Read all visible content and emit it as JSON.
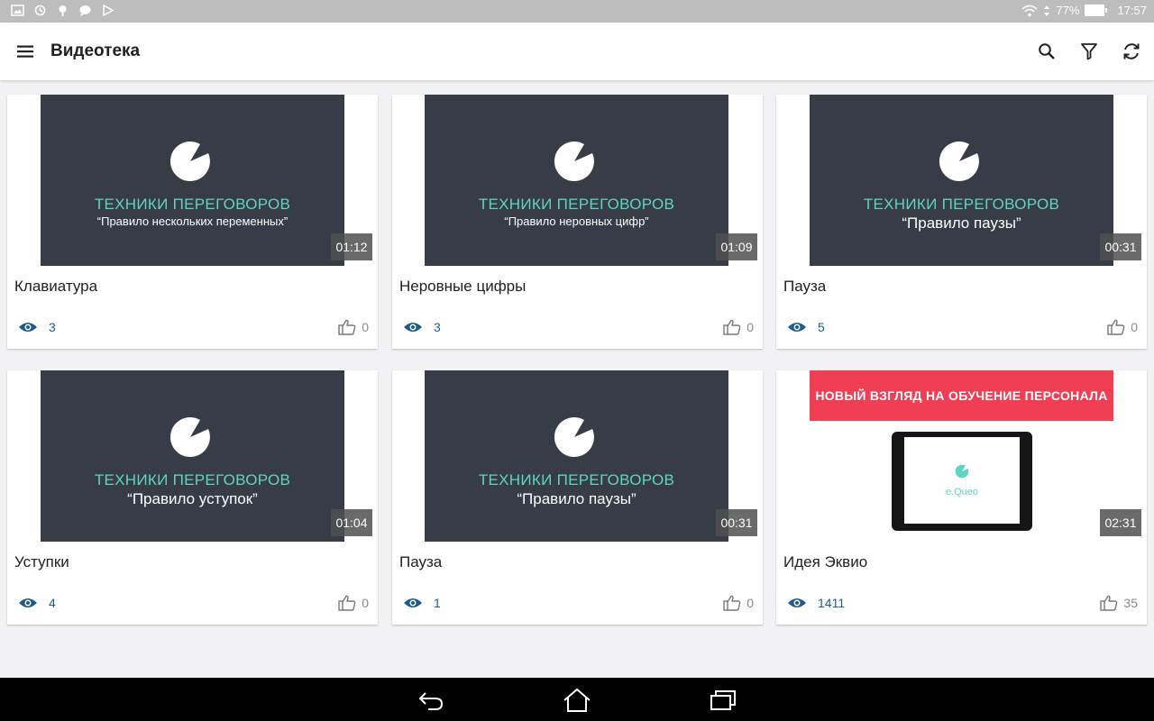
{
  "status_bar": {
    "battery": "77%",
    "time": "17:57"
  },
  "app_bar": {
    "title": "Видеотека"
  },
  "colors": {
    "accent": "#5fd4c4",
    "promo": "#f03e55",
    "views": "#1e5a8c",
    "thumb_bg": "#383c47"
  },
  "icons": {
    "menu": "menu-icon",
    "search": "search-icon",
    "filter": "filter-icon",
    "refresh": "refresh-icon",
    "views": "eye-icon",
    "likes": "thumbs-up-icon",
    "back": "back-icon",
    "home": "home-icon",
    "recents": "recents-icon"
  },
  "videos": [
    {
      "thumb_title": "ТЕХНИКИ ПЕРЕГОВОРОВ",
      "thumb_subtitle": "“Правило нескольких переменных”",
      "duration": "01:12",
      "title": "Клавиатура",
      "views": "3",
      "likes": "0"
    },
    {
      "thumb_title": "ТЕХНИКИ ПЕРЕГОВОРОВ",
      "thumb_subtitle": "“Правило неровных цифр”",
      "duration": "01:09",
      "title": "Неровные цифры",
      "views": "3",
      "likes": "0"
    },
    {
      "thumb_title": "ТЕХНИКИ ПЕРЕГОВОРОВ",
      "thumb_subtitle": "“Правило паузы”",
      "duration": "00:31",
      "title": "Пауза",
      "views": "5",
      "likes": "0"
    },
    {
      "thumb_title": "ТЕХНИКИ ПЕРЕГОВОРОВ",
      "thumb_subtitle": "“Правило уступок”",
      "duration": "01:04",
      "title": "Уступки",
      "views": "4",
      "likes": "0"
    },
    {
      "thumb_title": "ТЕХНИКИ ПЕРЕГОВОРОВ",
      "thumb_subtitle": "“Правило паузы”",
      "duration": "00:31",
      "title": "Пауза",
      "views": "1",
      "likes": "0"
    },
    {
      "thumb_banner": "НОВЫЙ ВЗГЛЯД НА ОБУЧЕНИЕ ПЕРСОНАЛА",
      "thumb_logo": "e.Queo",
      "duration": "02:31",
      "title": "Идея Эквио",
      "views": "1411",
      "likes": "35"
    }
  ]
}
